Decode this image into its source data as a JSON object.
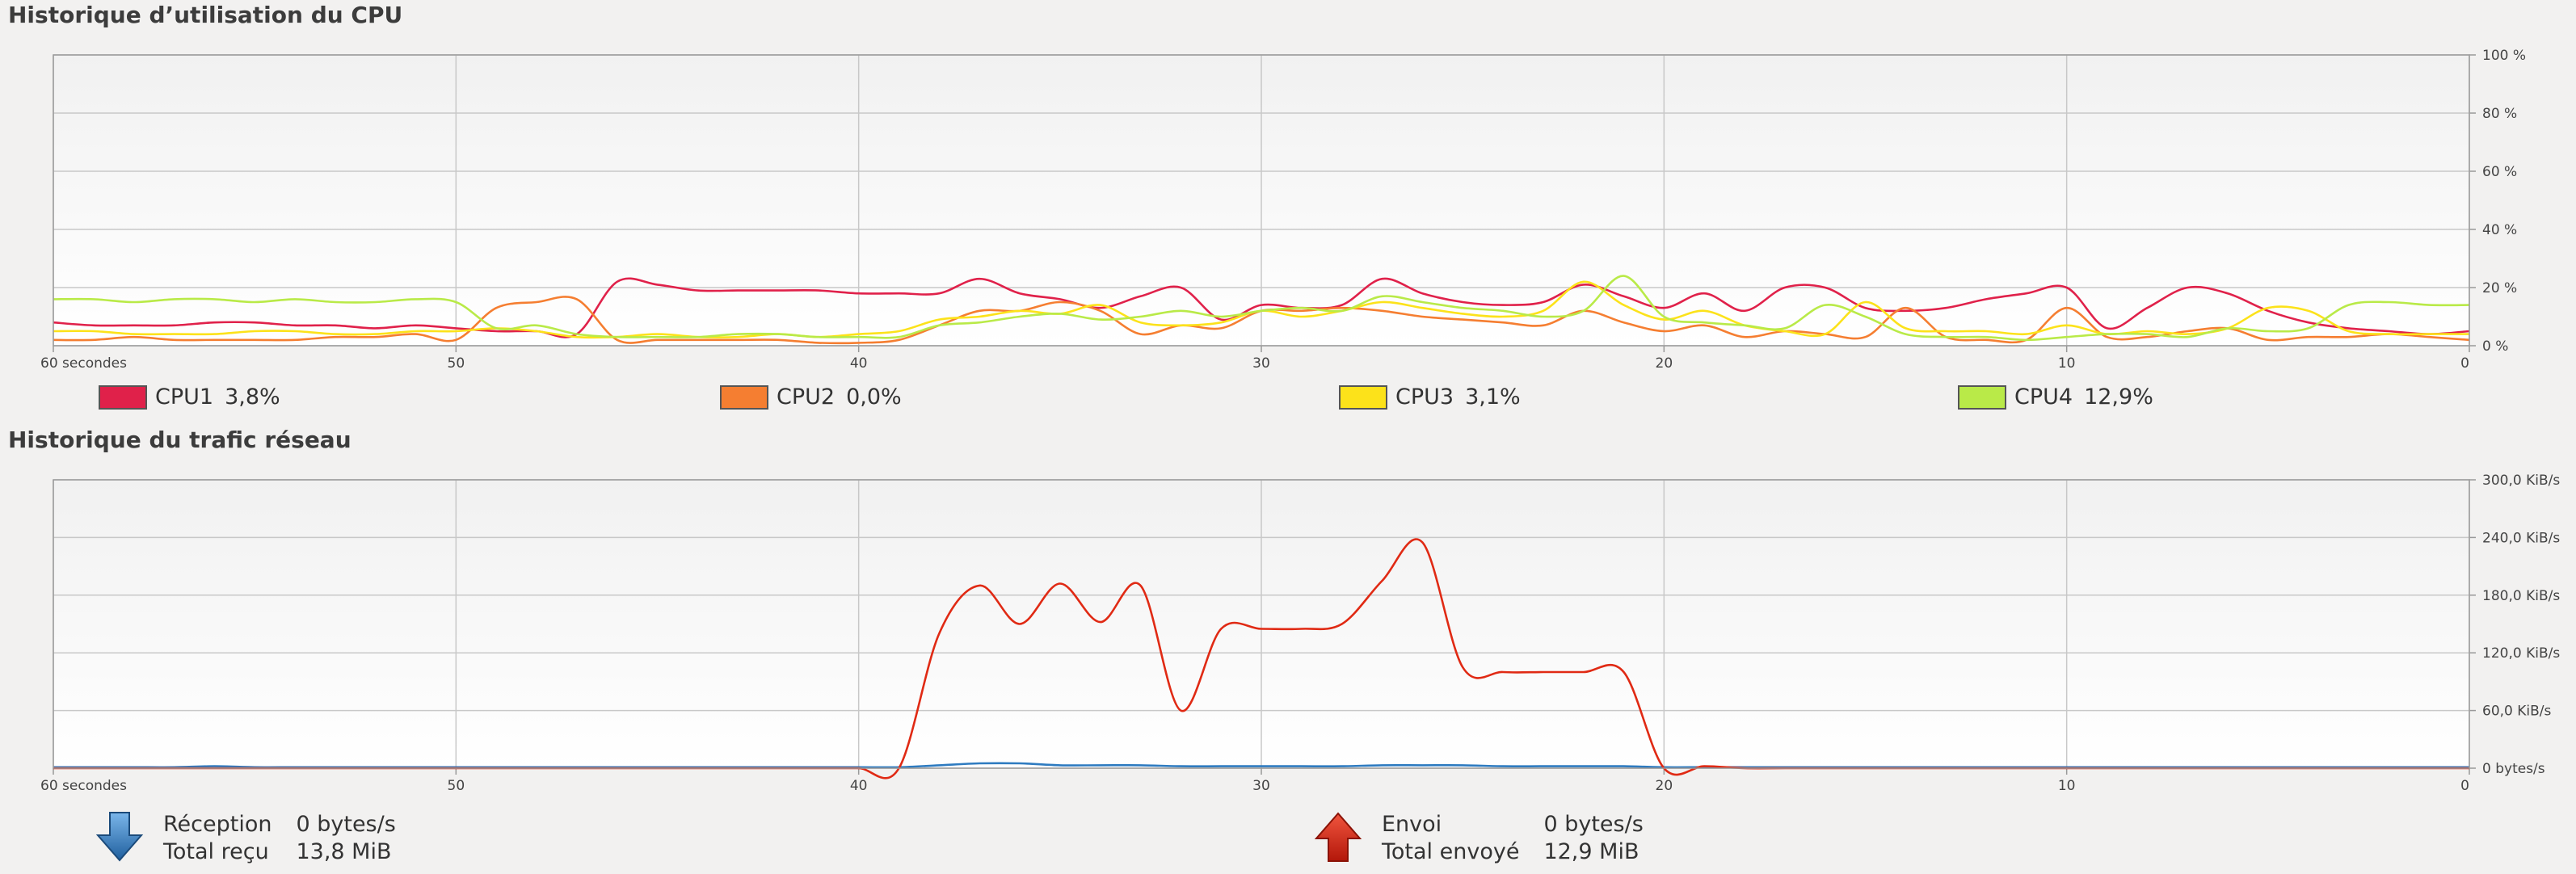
{
  "cpu_section": {
    "title": "Historique d’utilisation du CPU",
    "legend": [
      {
        "label": "CPU1",
        "value": "3,8%",
        "color": "#e0214a"
      },
      {
        "label": "CPU2",
        "value": "0,0%",
        "color": "#f57e31"
      },
      {
        "label": "CPU3",
        "value": "3,1%",
        "color": "#fce21a"
      },
      {
        "label": "CPU4",
        "value": "12,9%",
        "color": "#b9ea48"
      }
    ]
  },
  "network_section": {
    "title": "Historique du trafic réseau",
    "reception": {
      "label": "Réception",
      "rate": "0 bytes/s",
      "total_label": "Total reçu",
      "total": "13,8 MiB",
      "color": "#2e7bc0"
    },
    "sending": {
      "label": "Envoi",
      "rate": "0 bytes/s",
      "total_label": "Total envoyé",
      "total": "12,9 MiB",
      "color": "#e02a14"
    }
  },
  "chart_data": [
    {
      "type": "line",
      "x": [
        60,
        59,
        58,
        57,
        56,
        55,
        54,
        53,
        52,
        51,
        50,
        49,
        48,
        47,
        46,
        45,
        44,
        43,
        42,
        41,
        40,
        39,
        38,
        37,
        36,
        35,
        34,
        33,
        32,
        31,
        30,
        29,
        28,
        27,
        26,
        25,
        24,
        23,
        22,
        21,
        20,
        19,
        18,
        17,
        16,
        15,
        14,
        13,
        12,
        11,
        10,
        9,
        8,
        7,
        6,
        5,
        4,
        3,
        2,
        1,
        0
      ],
      "x_ticks": [
        {
          "v": 60,
          "label": "60 secondes"
        },
        {
          "v": 50,
          "label": "50"
        },
        {
          "v": 40,
          "label": "40"
        },
        {
          "v": 30,
          "label": "30"
        },
        {
          "v": 20,
          "label": "20"
        },
        {
          "v": 10,
          "label": "10"
        },
        {
          "v": 0,
          "label": "0"
        }
      ],
      "y_ticks": [
        {
          "v": 100,
          "label": "100 %"
        },
        {
          "v": 80,
          "label": "80 %"
        },
        {
          "v": 60,
          "label": "60 %"
        },
        {
          "v": 40,
          "label": "40 %"
        },
        {
          "v": 20,
          "label": "20 %"
        },
        {
          "v": 0,
          "label": "0 %"
        }
      ],
      "ylim": [
        0,
        100
      ],
      "xlim": [
        60,
        0
      ],
      "grid": true,
      "series": [
        {
          "name": "CPU1",
          "color": "#e0214a",
          "values": [
            8,
            7,
            7,
            7,
            8,
            8,
            7,
            7,
            6,
            7,
            6,
            5,
            5,
            4,
            22,
            21,
            19,
            19,
            19,
            19,
            18,
            18,
            18,
            23,
            18,
            16,
            13,
            17,
            20,
            9,
            14,
            13,
            14,
            23,
            18,
            15,
            14,
            15,
            21,
            17,
            13,
            18,
            12,
            20,
            20,
            13,
            12,
            13,
            16,
            18,
            20,
            6,
            13,
            20,
            18,
            12,
            8,
            6,
            5,
            4,
            5
          ]
        },
        {
          "name": "CPU2",
          "color": "#f57e31",
          "values": [
            2,
            2,
            3,
            2,
            2,
            2,
            2,
            3,
            3,
            4,
            2,
            13,
            15,
            16,
            2,
            2,
            2,
            2,
            2,
            1,
            1,
            2,
            7,
            12,
            12,
            15,
            12,
            4,
            7,
            6,
            12,
            12,
            13,
            12,
            10,
            9,
            8,
            7,
            12,
            8,
            5,
            7,
            3,
            5,
            4,
            3,
            13,
            3,
            2,
            2,
            13,
            3,
            3,
            5,
            6,
            2,
            3,
            3,
            4,
            3,
            2
          ]
        },
        {
          "name": "CPU3",
          "color": "#fce21a",
          "values": [
            5,
            5,
            4,
            4,
            4,
            5,
            5,
            4,
            4,
            5,
            5,
            6,
            5,
            3,
            3,
            4,
            3,
            3,
            4,
            3,
            4,
            5,
            9,
            10,
            12,
            11,
            14,
            8,
            7,
            8,
            12,
            10,
            12,
            15,
            13,
            11,
            10,
            12,
            22,
            14,
            9,
            12,
            7,
            5,
            4,
            15,
            6,
            5,
            5,
            4,
            7,
            4,
            5,
            4,
            6,
            13,
            12,
            5,
            4,
            4,
            4
          ]
        },
        {
          "name": "CPU4",
          "color": "#b9ea48",
          "values": [
            16,
            16,
            15,
            16,
            16,
            15,
            16,
            15,
            15,
            16,
            15,
            6,
            7,
            4,
            3,
            3,
            3,
            4,
            4,
            3,
            3,
            3,
            7,
            8,
            10,
            11,
            9,
            10,
            12,
            10,
            12,
            13,
            12,
            17,
            15,
            13,
            12,
            10,
            12,
            24,
            10,
            8,
            7,
            6,
            14,
            10,
            4,
            3,
            3,
            2,
            3,
            4,
            4,
            3,
            6,
            5,
            6,
            14,
            15,
            14,
            14
          ]
        }
      ]
    },
    {
      "type": "line",
      "x": [
        60,
        59,
        58,
        57,
        56,
        55,
        54,
        53,
        52,
        51,
        50,
        49,
        48,
        47,
        46,
        45,
        44,
        43,
        42,
        41,
        40,
        39,
        38,
        37,
        36,
        35,
        34,
        33,
        32,
        31,
        30,
        29,
        28,
        27,
        26,
        25,
        24,
        23,
        22,
        21,
        20,
        19,
        18,
        17,
        16,
        15,
        14,
        13,
        12,
        11,
        10,
        9,
        8,
        7,
        6,
        5,
        4,
        3,
        2,
        1,
        0
      ],
      "x_ticks": [
        {
          "v": 60,
          "label": "60 secondes"
        },
        {
          "v": 50,
          "label": "50"
        },
        {
          "v": 40,
          "label": "40"
        },
        {
          "v": 30,
          "label": "30"
        },
        {
          "v": 20,
          "label": "20"
        },
        {
          "v": 10,
          "label": "10"
        },
        {
          "v": 0,
          "label": "0"
        }
      ],
      "y_ticks": [
        {
          "v": 300,
          "label": "300,0 KiB/s"
        },
        {
          "v": 240,
          "label": "240,0 KiB/s"
        },
        {
          "v": 180,
          "label": "180,0 KiB/s"
        },
        {
          "v": 120,
          "label": "120,0 KiB/s"
        },
        {
          "v": 60,
          "label": "60,0 KiB/s"
        },
        {
          "v": 0,
          "label": "0 bytes/s"
        }
      ],
      "ylim": [
        0,
        300
      ],
      "xlim": [
        60,
        0
      ],
      "grid": true,
      "series": [
        {
          "name": "Réception",
          "color": "#2e7bc0",
          "values": [
            1,
            1,
            1,
            1,
            2,
            1,
            1,
            1,
            1,
            1,
            1,
            1,
            1,
            1,
            1,
            1,
            1,
            1,
            1,
            1,
            1,
            1,
            3,
            5,
            5,
            3,
            3,
            3,
            2,
            2,
            2,
            2,
            2,
            3,
            3,
            3,
            2,
            2,
            2,
            2,
            1,
            1,
            1,
            1,
            1,
            1,
            1,
            1,
            1,
            1,
            1,
            1,
            1,
            1,
            1,
            1,
            1,
            1,
            1,
            1,
            1
          ]
        },
        {
          "name": "Envoi",
          "color": "#e02a14",
          "values": [
            0,
            0,
            0,
            0,
            0,
            0,
            0,
            0,
            0,
            0,
            0,
            0,
            0,
            0,
            0,
            0,
            0,
            0,
            0,
            0,
            0,
            0,
            140,
            190,
            150,
            192,
            152,
            190,
            60,
            145,
            145,
            145,
            150,
            195,
            235,
            105,
            100,
            100,
            100,
            100,
            0,
            2,
            0,
            0,
            0,
            0,
            0,
            0,
            0,
            0,
            0,
            0,
            0,
            0,
            0,
            0,
            0,
            0,
            0,
            0,
            0
          ]
        }
      ]
    }
  ]
}
